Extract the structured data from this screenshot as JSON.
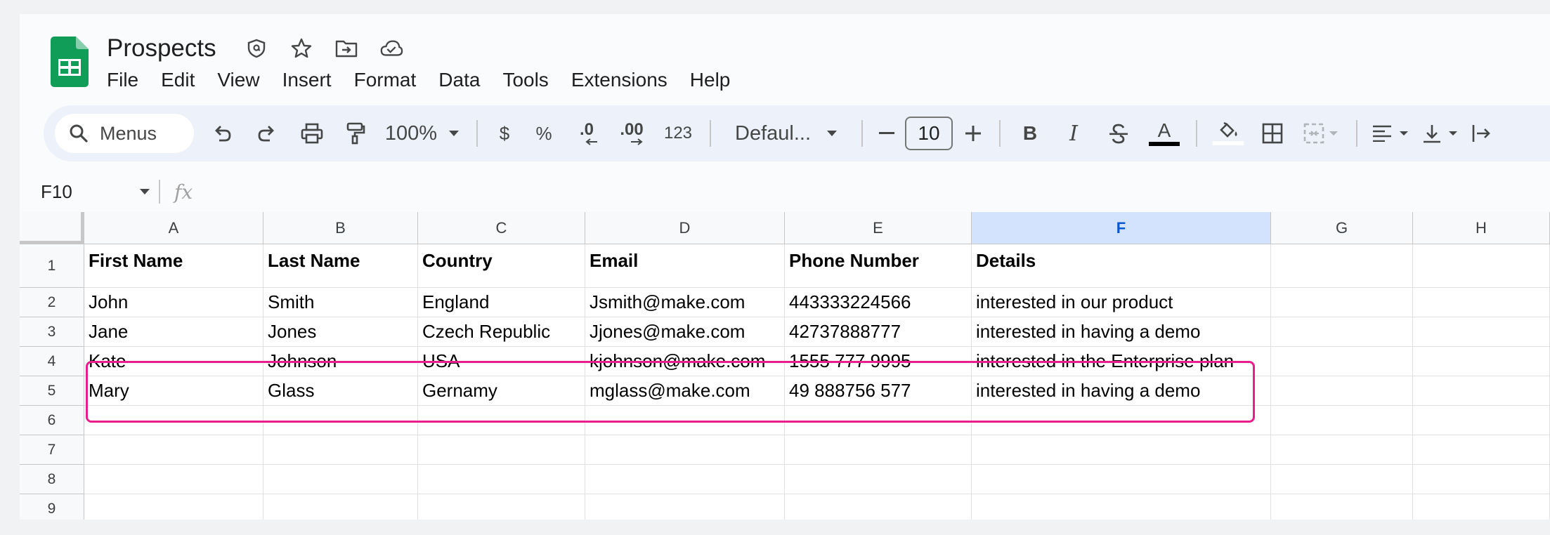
{
  "document": {
    "title": "Prospects"
  },
  "menu": [
    "File",
    "Edit",
    "View",
    "Insert",
    "Format",
    "Data",
    "Tools",
    "Extensions",
    "Help"
  ],
  "toolbar": {
    "search_label": "Menus",
    "zoom": "100%",
    "currency": "$",
    "percent": "%",
    "decrease_decimal": ".0",
    "increase_decimal": ".00",
    "number_format": "123",
    "font": "Defaul...",
    "font_size": "10",
    "bold": "B",
    "italic": "I",
    "text_color_glyph": "A"
  },
  "formula_bar": {
    "cell_ref": "F10",
    "fx": "fx"
  },
  "columns": [
    "A",
    "B",
    "C",
    "D",
    "E",
    "F",
    "G",
    "H"
  ],
  "selected_column": "F",
  "rows": [
    "1",
    "2",
    "3",
    "4",
    "5",
    "6",
    "7",
    "8",
    "9"
  ],
  "header_row": [
    "First Name",
    "Last Name",
    "Country",
    "Email",
    "Phone Number",
    "Details"
  ],
  "data_rows": [
    [
      "John",
      "Smith",
      "England",
      "Jsmith@make.com",
      "443333224566",
      "interested in our product"
    ],
    [
      "Jane",
      "Jones",
      "Czech Republic",
      "Jjones@make.com",
      "42737888777",
      "interested in having a demo"
    ],
    [
      "Kate",
      "Johnson",
      "USA",
      "kjohnson@make.com",
      "1555 777 9995",
      "interested in the Enterprise plan"
    ],
    [
      "Mary",
      "Glass",
      "Gernamy",
      "mglass@make.com",
      "49 888756 577",
      "interested in having a demo"
    ]
  ],
  "colors": {
    "selected_header": "#d3e3fd",
    "highlight": "#e91e8c",
    "sheets_green": "#0f9d58"
  }
}
